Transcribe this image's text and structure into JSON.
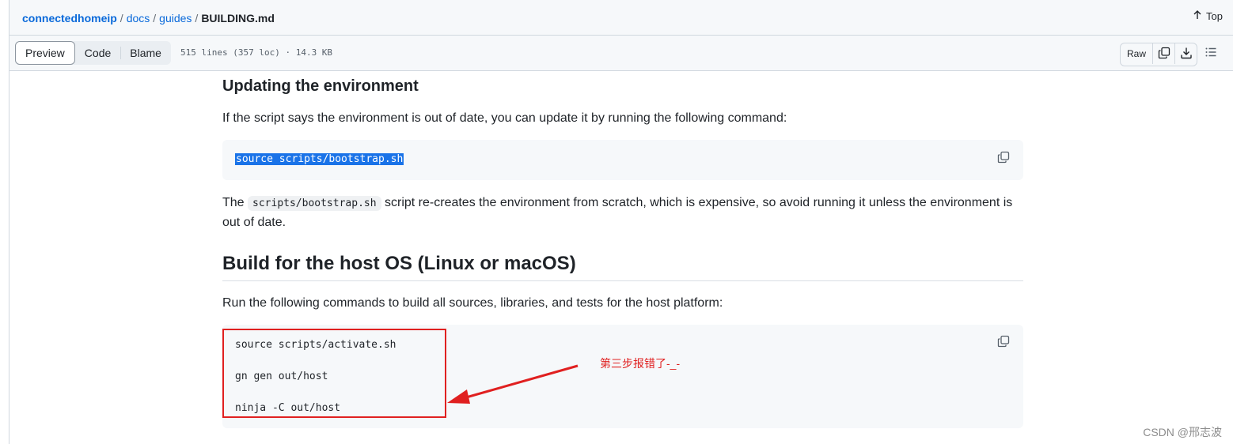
{
  "breadcrumb": {
    "repo": "connectedhomeip",
    "folder1": "docs",
    "folder2": "guides",
    "file": "BUILDING.md",
    "separator": "/"
  },
  "top_link": "Top",
  "toolbar": {
    "tabs": [
      "Preview",
      "Code",
      "Blame"
    ],
    "active_tab": "Preview",
    "file_info": "515 lines (357 loc) · 14.3 KB",
    "raw_label": "Raw"
  },
  "content": {
    "update_heading": "Updating the environment",
    "update_para": "If the script says the environment is out of date, you can update it by running the following command:",
    "update_code": "source scripts/bootstrap.sh",
    "bootstrap_pre": "The ",
    "bootstrap_inline": "scripts/bootstrap.sh",
    "bootstrap_post": " script re-creates the environment from scratch, which is expensive, so avoid running it unless the environment is",
    "bootstrap_post2": "out of date.",
    "build_heading": "Build for the host OS (Linux or macOS)",
    "build_para": "Run the following commands to build all sources, libraries, and tests for the host platform:",
    "build_code": [
      "source scripts/activate.sh",
      "gn gen out/host",
      "ninja -C out/host"
    ]
  },
  "annotation": {
    "note": "第三步报错了-_-",
    "color": "#e02020"
  },
  "watermark": "CSDN @邢志波",
  "colors": {
    "link": "#0969da",
    "selection": "#1a73e8",
    "code_bg": "#f6f8fa"
  }
}
